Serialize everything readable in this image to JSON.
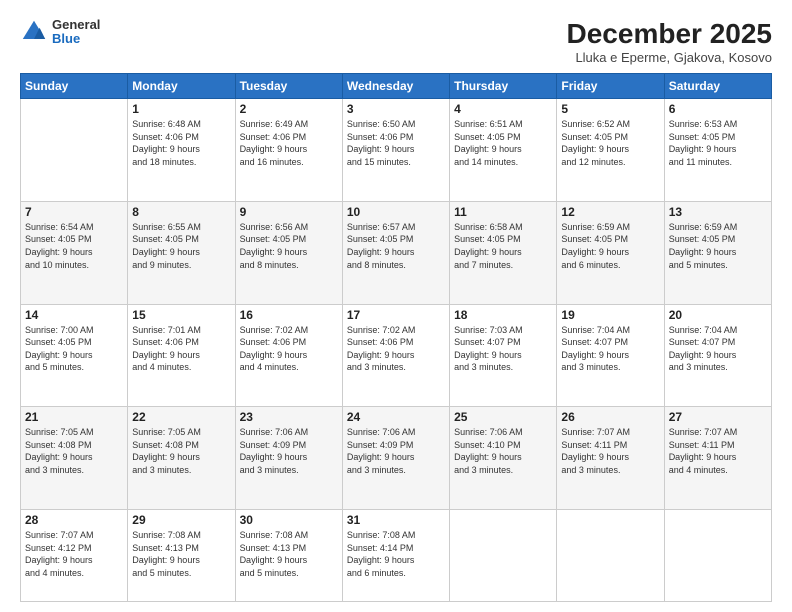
{
  "header": {
    "logo": {
      "general": "General",
      "blue": "Blue"
    },
    "title": "December 2025",
    "location": "Lluka e Eperme, Gjakova, Kosovo"
  },
  "weekdays": [
    "Sunday",
    "Monday",
    "Tuesday",
    "Wednesday",
    "Thursday",
    "Friday",
    "Saturday"
  ],
  "weeks": [
    [
      {
        "day": "",
        "info": ""
      },
      {
        "day": "1",
        "info": "Sunrise: 6:48 AM\nSunset: 4:06 PM\nDaylight: 9 hours\nand 18 minutes."
      },
      {
        "day": "2",
        "info": "Sunrise: 6:49 AM\nSunset: 4:06 PM\nDaylight: 9 hours\nand 16 minutes."
      },
      {
        "day": "3",
        "info": "Sunrise: 6:50 AM\nSunset: 4:06 PM\nDaylight: 9 hours\nand 15 minutes."
      },
      {
        "day": "4",
        "info": "Sunrise: 6:51 AM\nSunset: 4:05 PM\nDaylight: 9 hours\nand 14 minutes."
      },
      {
        "day": "5",
        "info": "Sunrise: 6:52 AM\nSunset: 4:05 PM\nDaylight: 9 hours\nand 12 minutes."
      },
      {
        "day": "6",
        "info": "Sunrise: 6:53 AM\nSunset: 4:05 PM\nDaylight: 9 hours\nand 11 minutes."
      }
    ],
    [
      {
        "day": "7",
        "info": "Sunrise: 6:54 AM\nSunset: 4:05 PM\nDaylight: 9 hours\nand 10 minutes."
      },
      {
        "day": "8",
        "info": "Sunrise: 6:55 AM\nSunset: 4:05 PM\nDaylight: 9 hours\nand 9 minutes."
      },
      {
        "day": "9",
        "info": "Sunrise: 6:56 AM\nSunset: 4:05 PM\nDaylight: 9 hours\nand 8 minutes."
      },
      {
        "day": "10",
        "info": "Sunrise: 6:57 AM\nSunset: 4:05 PM\nDaylight: 9 hours\nand 8 minutes."
      },
      {
        "day": "11",
        "info": "Sunrise: 6:58 AM\nSunset: 4:05 PM\nDaylight: 9 hours\nand 7 minutes."
      },
      {
        "day": "12",
        "info": "Sunrise: 6:59 AM\nSunset: 4:05 PM\nDaylight: 9 hours\nand 6 minutes."
      },
      {
        "day": "13",
        "info": "Sunrise: 6:59 AM\nSunset: 4:05 PM\nDaylight: 9 hours\nand 5 minutes."
      }
    ],
    [
      {
        "day": "14",
        "info": "Sunrise: 7:00 AM\nSunset: 4:05 PM\nDaylight: 9 hours\nand 5 minutes."
      },
      {
        "day": "15",
        "info": "Sunrise: 7:01 AM\nSunset: 4:06 PM\nDaylight: 9 hours\nand 4 minutes."
      },
      {
        "day": "16",
        "info": "Sunrise: 7:02 AM\nSunset: 4:06 PM\nDaylight: 9 hours\nand 4 minutes."
      },
      {
        "day": "17",
        "info": "Sunrise: 7:02 AM\nSunset: 4:06 PM\nDaylight: 9 hours\nand 3 minutes."
      },
      {
        "day": "18",
        "info": "Sunrise: 7:03 AM\nSunset: 4:07 PM\nDaylight: 9 hours\nand 3 minutes."
      },
      {
        "day": "19",
        "info": "Sunrise: 7:04 AM\nSunset: 4:07 PM\nDaylight: 9 hours\nand 3 minutes."
      },
      {
        "day": "20",
        "info": "Sunrise: 7:04 AM\nSunset: 4:07 PM\nDaylight: 9 hours\nand 3 minutes."
      }
    ],
    [
      {
        "day": "21",
        "info": "Sunrise: 7:05 AM\nSunset: 4:08 PM\nDaylight: 9 hours\nand 3 minutes."
      },
      {
        "day": "22",
        "info": "Sunrise: 7:05 AM\nSunset: 4:08 PM\nDaylight: 9 hours\nand 3 minutes."
      },
      {
        "day": "23",
        "info": "Sunrise: 7:06 AM\nSunset: 4:09 PM\nDaylight: 9 hours\nand 3 minutes."
      },
      {
        "day": "24",
        "info": "Sunrise: 7:06 AM\nSunset: 4:09 PM\nDaylight: 9 hours\nand 3 minutes."
      },
      {
        "day": "25",
        "info": "Sunrise: 7:06 AM\nSunset: 4:10 PM\nDaylight: 9 hours\nand 3 minutes."
      },
      {
        "day": "26",
        "info": "Sunrise: 7:07 AM\nSunset: 4:11 PM\nDaylight: 9 hours\nand 3 minutes."
      },
      {
        "day": "27",
        "info": "Sunrise: 7:07 AM\nSunset: 4:11 PM\nDaylight: 9 hours\nand 4 minutes."
      }
    ],
    [
      {
        "day": "28",
        "info": "Sunrise: 7:07 AM\nSunset: 4:12 PM\nDaylight: 9 hours\nand 4 minutes."
      },
      {
        "day": "29",
        "info": "Sunrise: 7:08 AM\nSunset: 4:13 PM\nDaylight: 9 hours\nand 5 minutes."
      },
      {
        "day": "30",
        "info": "Sunrise: 7:08 AM\nSunset: 4:13 PM\nDaylight: 9 hours\nand 5 minutes."
      },
      {
        "day": "31",
        "info": "Sunrise: 7:08 AM\nSunset: 4:14 PM\nDaylight: 9 hours\nand 6 minutes."
      },
      {
        "day": "",
        "info": ""
      },
      {
        "day": "",
        "info": ""
      },
      {
        "day": "",
        "info": ""
      }
    ]
  ]
}
